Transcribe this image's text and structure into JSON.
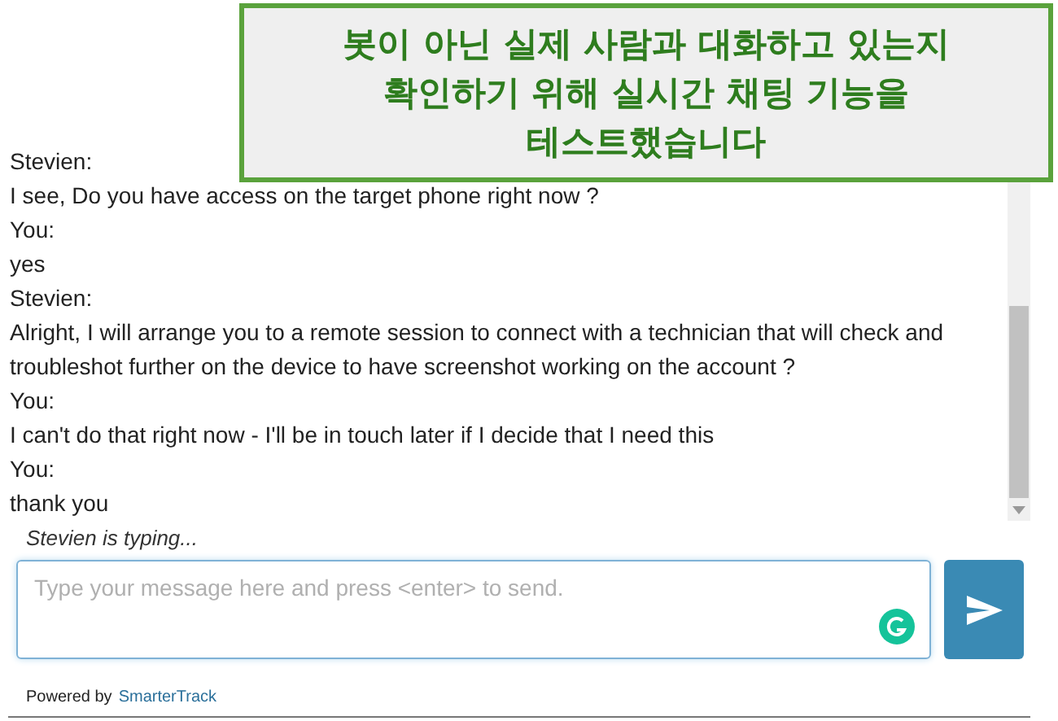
{
  "annotation": {
    "lines": [
      "봇이 아닌 실제 사람과 대화하고 있는지",
      "확인하기 위해 실시간 채팅 기능을",
      "테스트했습니다"
    ]
  },
  "messages": [
    {
      "sender": "Stevien:",
      "text": "I see, Do you have access on the target phone right now ?"
    },
    {
      "sender": "You:",
      "text": "yes"
    },
    {
      "sender": "Stevien:",
      "text": "Alright, I will arrange you to a remote session to connect with a technician that will check and troubleshot further on the device to have screenshot working on the account ?"
    },
    {
      "sender": "You:",
      "text": "I can't do that right now - I'll be in touch later if I decide that I need this"
    },
    {
      "sender": "You:",
      "text": "thank you"
    }
  ],
  "typing": "Stevien is typing...",
  "composer": {
    "placeholder": "Type your message here and press <enter> to send."
  },
  "footer": {
    "prefix": "Powered by",
    "link": "SmarterTrack"
  }
}
